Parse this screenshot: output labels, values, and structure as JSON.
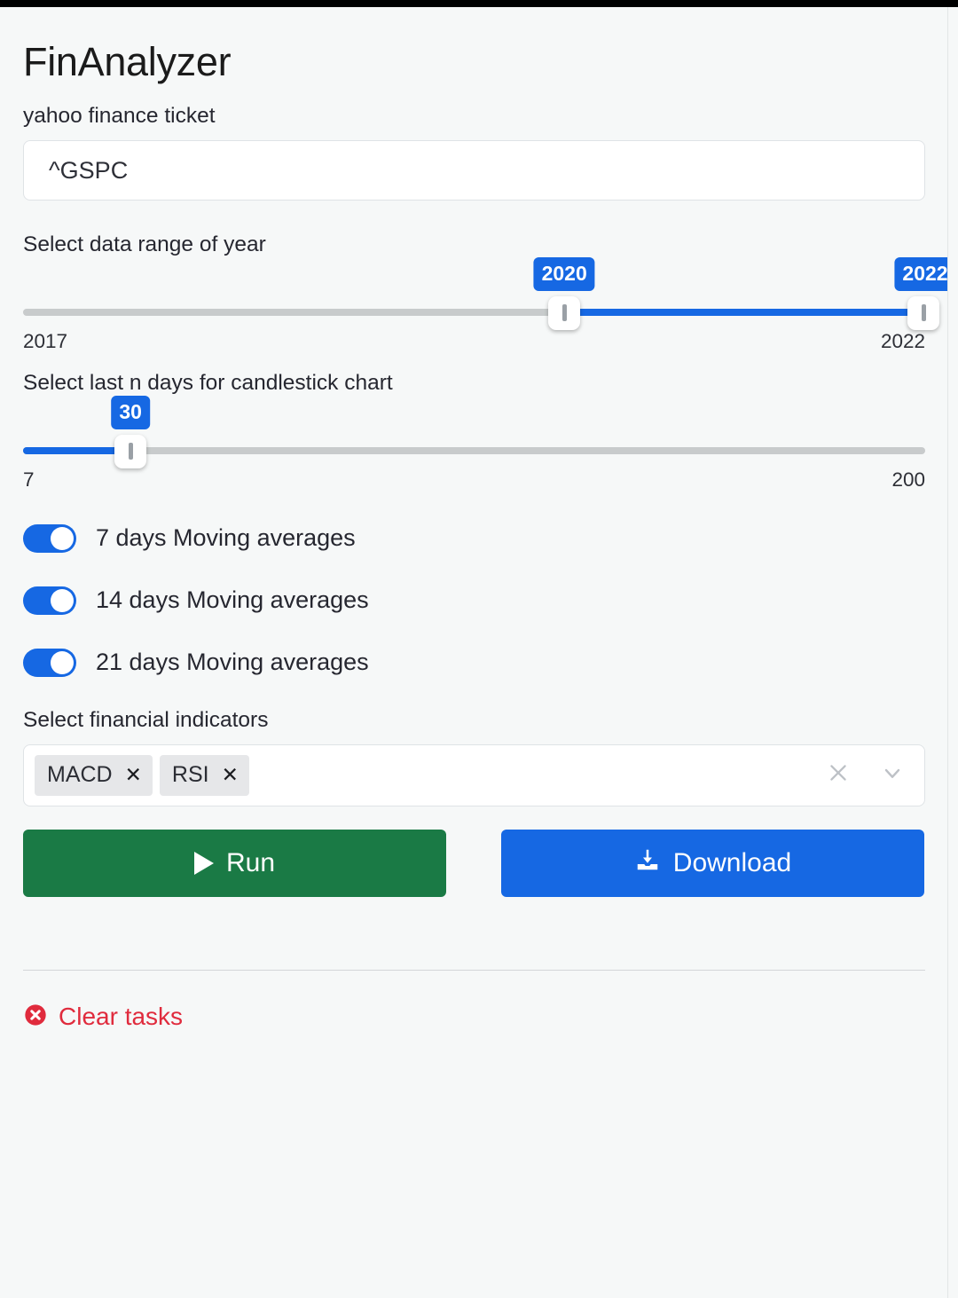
{
  "app": {
    "title": "FinAnalyzer",
    "background_color": "#f6f8f8",
    "accent_color": "#1668e3",
    "run_color": "#1a7a45",
    "danger_color": "#e02b3d"
  },
  "ticker_field": {
    "label": "yahoo finance ticket",
    "value": "^GSPC",
    "placeholder": "yahoo finance ticket"
  },
  "year_range_slider": {
    "label": "Select data range of year",
    "min": 2017,
    "max": 2022,
    "min_label": "2017",
    "max_label": "2022",
    "value_low": 2020,
    "value_high": 2022,
    "value_low_label": "2020",
    "value_high_label": "2022"
  },
  "days_slider": {
    "label": "Select last n days for candlestick chart",
    "min": 7,
    "max": 200,
    "min_label": "7",
    "max_label": "200",
    "value": 30,
    "value_label": "30"
  },
  "moving_averages": [
    {
      "label": "7 days Moving averages",
      "enabled": true
    },
    {
      "label": "14 days Moving averages",
      "enabled": true
    },
    {
      "label": "21 days Moving averages",
      "enabled": true
    }
  ],
  "indicators": {
    "label": "Select financial indicators",
    "selected": [
      {
        "label": "MACD",
        "remove_glyph": "✕"
      },
      {
        "label": "RSI",
        "remove_glyph": "✕"
      }
    ]
  },
  "actions": {
    "run_label": "Run",
    "download_label": "Download"
  },
  "footer": {
    "clear_tasks_label": "Clear tasks"
  }
}
